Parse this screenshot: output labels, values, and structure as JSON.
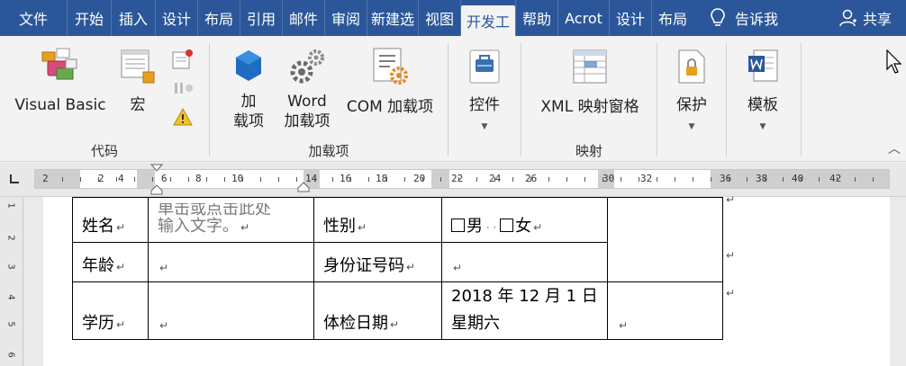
{
  "tabs": [
    {
      "label": "文件",
      "width": 74
    },
    {
      "label": "开始",
      "width": 48
    },
    {
      "label": "插入",
      "width": 48
    },
    {
      "label": "设计",
      "width": 46
    },
    {
      "label": "布局",
      "width": 46
    },
    {
      "label": "引用",
      "width": 46
    },
    {
      "label": "邮件",
      "width": 46
    },
    {
      "label": "审阅",
      "width": 46
    },
    {
      "label": "新建选",
      "width": 56
    },
    {
      "label": "视图",
      "width": 46
    },
    {
      "label": "开发工",
      "width": 60
    },
    {
      "label": "帮助",
      "width": 46
    },
    {
      "label": "Acrot",
      "width": 56
    },
    {
      "label": "设计",
      "width": 46
    },
    {
      "label": "布局",
      "width": 46
    }
  ],
  "tell_me": "告诉我",
  "share": "共享",
  "ribbon": {
    "code": {
      "label": "代码",
      "visual_basic": "Visual Basic",
      "macro": "宏"
    },
    "addins": {
      "label": "加载项",
      "addins_l1": "加",
      "addins_l2": "载项",
      "word_l1": "Word",
      "word_l2": "加载项",
      "com": "COM 加载项"
    },
    "controls": {
      "label": "控件"
    },
    "mapping": {
      "label": "映射",
      "xml": "XML 映射窗格"
    },
    "protect": {
      "label": "保护"
    },
    "templates": {
      "label": "模板"
    }
  },
  "ruler": {
    "numbers": [
      "2",
      "2",
      "4",
      "6",
      "8",
      "10",
      "14",
      "16",
      "18",
      "20",
      "22",
      "24",
      "26",
      "30",
      "32",
      "36",
      "38",
      "40",
      "42"
    ]
  },
  "vruler": [
    "1",
    "2",
    "3",
    "4",
    "5",
    "6"
  ],
  "table": {
    "r1c1": "姓名",
    "r1c2_line1": "单击或点击此处",
    "r1c2_line2": "输入文字。",
    "r1c3": "性别",
    "r1c4_male": "男",
    "r1c4_female": "女",
    "r2c1": "年龄",
    "r2c3": "身份证号码",
    "r3c1": "学历",
    "r3c3": "体检日期",
    "r3c4_line1": "2018 年 12 月 1 日",
    "r3c4_line2": "星期六"
  },
  "para_mark": "↵",
  "colors": {
    "accent": "#2b579a",
    "ribbon_bg": "#f3f3f3"
  }
}
